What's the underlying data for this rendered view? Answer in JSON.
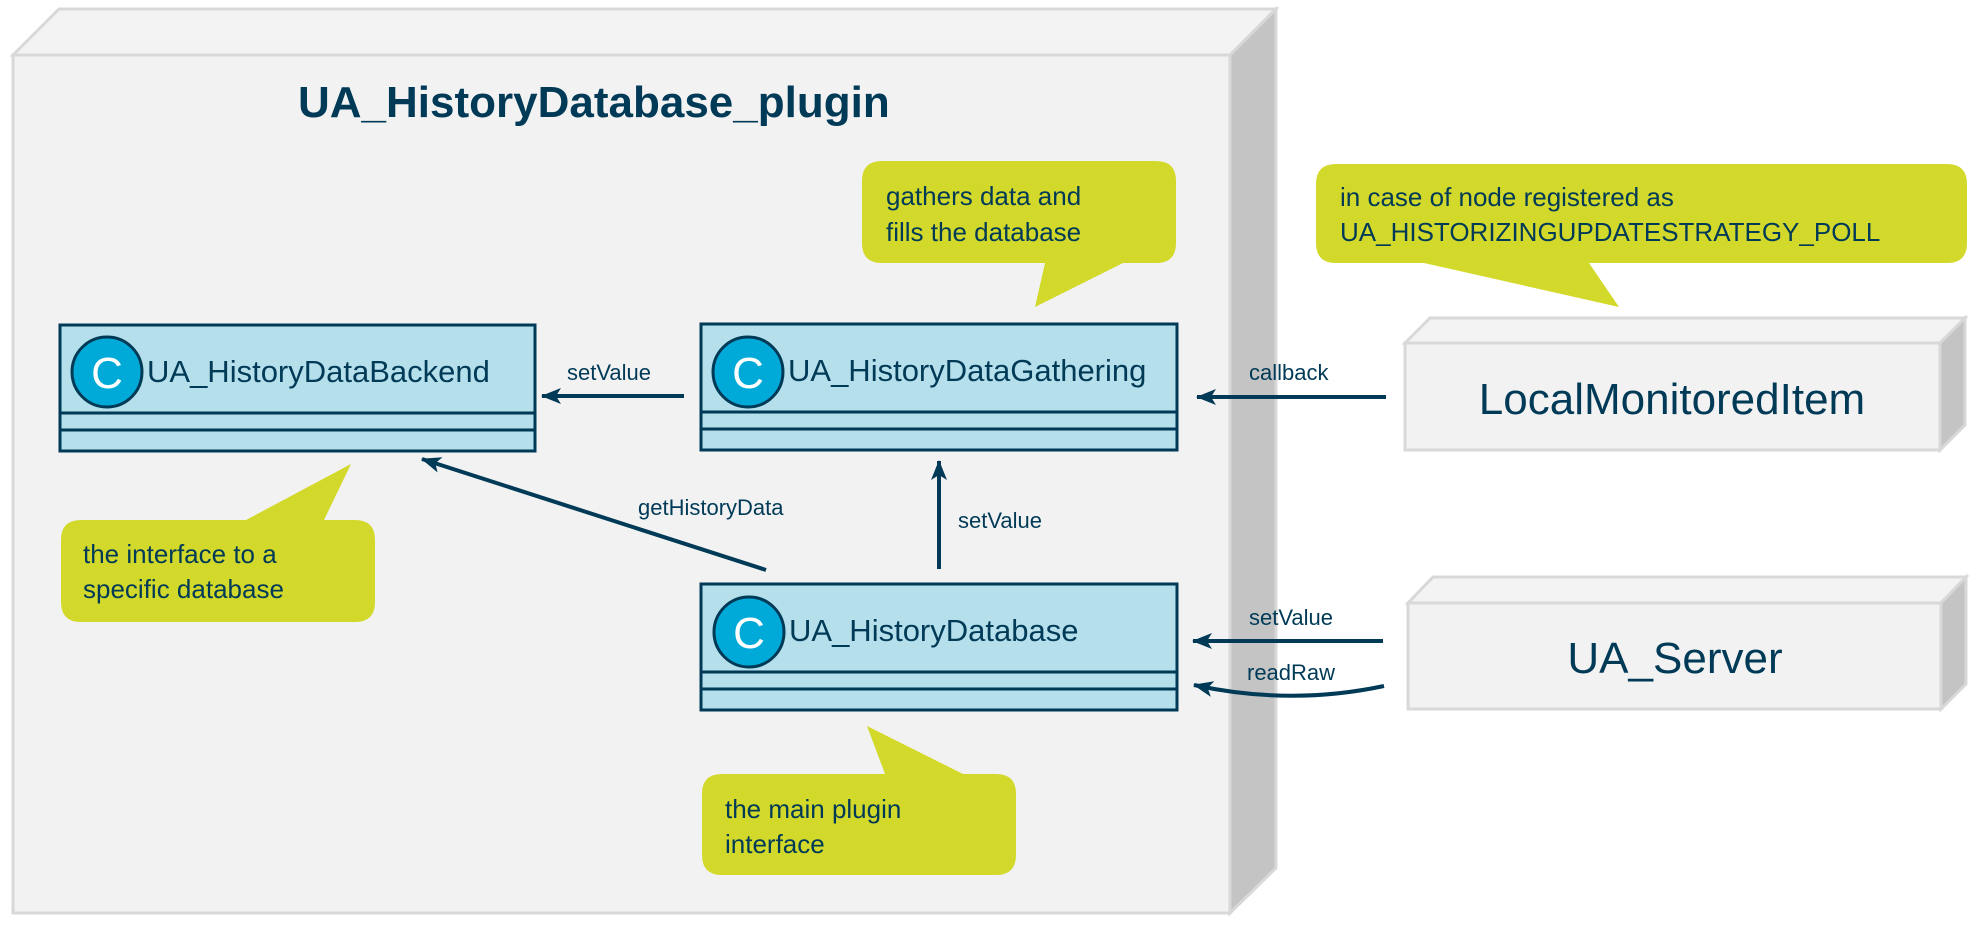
{
  "colors": {
    "ink": "#003a57",
    "class_fill": "#b4dfeb",
    "circle_fill": "#00aad8",
    "note_fill": "#d3d92a",
    "frame_front": "#f2f2f2",
    "frame_side": "#c4c4c4",
    "frame_stroke": "#d8d8d8"
  },
  "package": {
    "title": "UA_HistoryDatabase_plugin"
  },
  "classes": [
    {
      "id": "backend",
      "stereotype_letter": "C",
      "name": "UA_HistoryDataBackend"
    },
    {
      "id": "gathering",
      "stereotype_letter": "C",
      "name": "UA_HistoryDataGathering"
    },
    {
      "id": "database",
      "stereotype_letter": "C",
      "name": "UA_HistoryDatabase"
    }
  ],
  "nodes": [
    {
      "id": "local-monitored-item",
      "name": "LocalMonitoredItem"
    },
    {
      "id": "ua-server",
      "name": "UA_Server"
    }
  ],
  "notes": [
    {
      "id": "note-backend",
      "lines": [
        "the interface to a",
        "specific database"
      ],
      "target": "UA_HistoryDataBackend"
    },
    {
      "id": "note-gathering",
      "lines": [
        "gathers data and",
        "fills the database"
      ],
      "target": "UA_HistoryDataGathering"
    },
    {
      "id": "note-database",
      "lines": [
        "the main plugin",
        "interface"
      ],
      "target": "UA_HistoryDatabase"
    },
    {
      "id": "note-monitored",
      "lines": [
        "in case of node registered as",
        "UA_HISTORIZINGUPDATESTRATEGY_POLL"
      ],
      "target": "LocalMonitoredItem"
    }
  ],
  "edges": [
    {
      "id": "gathering-to-backend",
      "from": "UA_HistoryDataGathering",
      "to": "UA_HistoryDataBackend",
      "label": "setValue"
    },
    {
      "id": "database-to-backend",
      "from": "UA_HistoryDatabase",
      "to": "UA_HistoryDataBackend",
      "label": "getHistoryData"
    },
    {
      "id": "database-to-gathering",
      "from": "UA_HistoryDatabase",
      "to": "UA_HistoryDataGathering",
      "label": "setValue"
    },
    {
      "id": "monitored-to-gathering",
      "from": "LocalMonitoredItem",
      "to": "UA_HistoryDataGathering",
      "label": "callback"
    },
    {
      "id": "server-to-database-set",
      "from": "UA_Server",
      "to": "UA_HistoryDatabase",
      "label": "setValue"
    },
    {
      "id": "server-to-database-read",
      "from": "UA_Server",
      "to": "UA_HistoryDatabase",
      "label": "readRaw"
    }
  ]
}
